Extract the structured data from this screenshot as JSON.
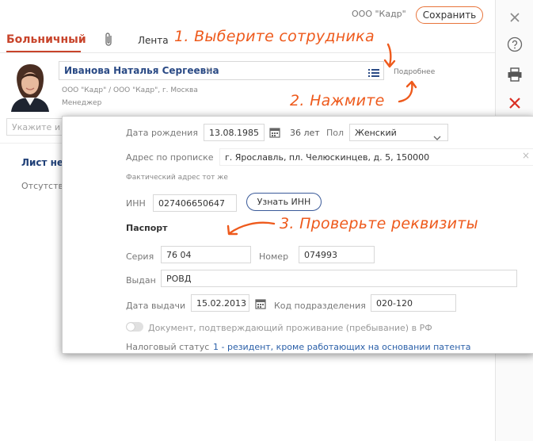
{
  "header": {
    "company": "ООО \"Кадр\"",
    "save_label": "Сохранить",
    "tab_sick": "Больничный",
    "tab_feed": "Лента"
  },
  "annotations": {
    "step1": "1. Выберите сотрудника",
    "step2": "2. Нажмите",
    "step3": "3. Проверьте реквизиты"
  },
  "employee": {
    "name": "Иванова Наталья Сергеевна",
    "more_link": "Подробнее",
    "org": "ООО \"Кадр\" / ООО \"Кадр\", г. Москва",
    "position": "Менеджер"
  },
  "background": {
    "search_placeholder": "Укажите и",
    "sheet_title": "Лист не",
    "absence": "Отсутств"
  },
  "popup": {
    "dob_label": "Дата рождения",
    "dob_value": "13.08.1985",
    "age": "36 лет",
    "sex_label": "Пол",
    "sex_value": "Женский",
    "reg_label": "Адрес по прописке",
    "reg_value": "г. Ярославль, пл. Челюскинцев, д. 5, 150000",
    "actual_address": "Фактический адрес тот же",
    "inn_label": "ИНН",
    "inn_value": "027406650647",
    "inn_button": "Узнать ИНН",
    "passport_title": "Паспорт",
    "series_label": "Серия",
    "series_value": "76 04",
    "number_label": "Номер",
    "number_value": "074993",
    "issued_label": "Выдан",
    "issued_value": "РОВД",
    "issue_date_label": "Дата выдачи",
    "issue_date_value": "15.02.2013",
    "dept_label": "Код подразделения",
    "dept_value": "020-120",
    "doc_toggle_label": "Документ, подтверждающий проживание (пребывание) в РФ",
    "doc_toggle_on": false,
    "tax_label": "Налоговый статус",
    "tax_value": "1 - резидент, кроме работающих на основании патента"
  },
  "icons": {
    "close": "close-icon",
    "help": "help-icon",
    "print": "printer-icon",
    "delete": "delete-icon",
    "attach": "paperclip-icon",
    "list": "list-icon",
    "calendar": "calendar-icon"
  },
  "colors": {
    "accent": "#c8442b",
    "annotation": "#ee5a1c",
    "link": "#2a5fa8",
    "delete": "#d93025"
  }
}
